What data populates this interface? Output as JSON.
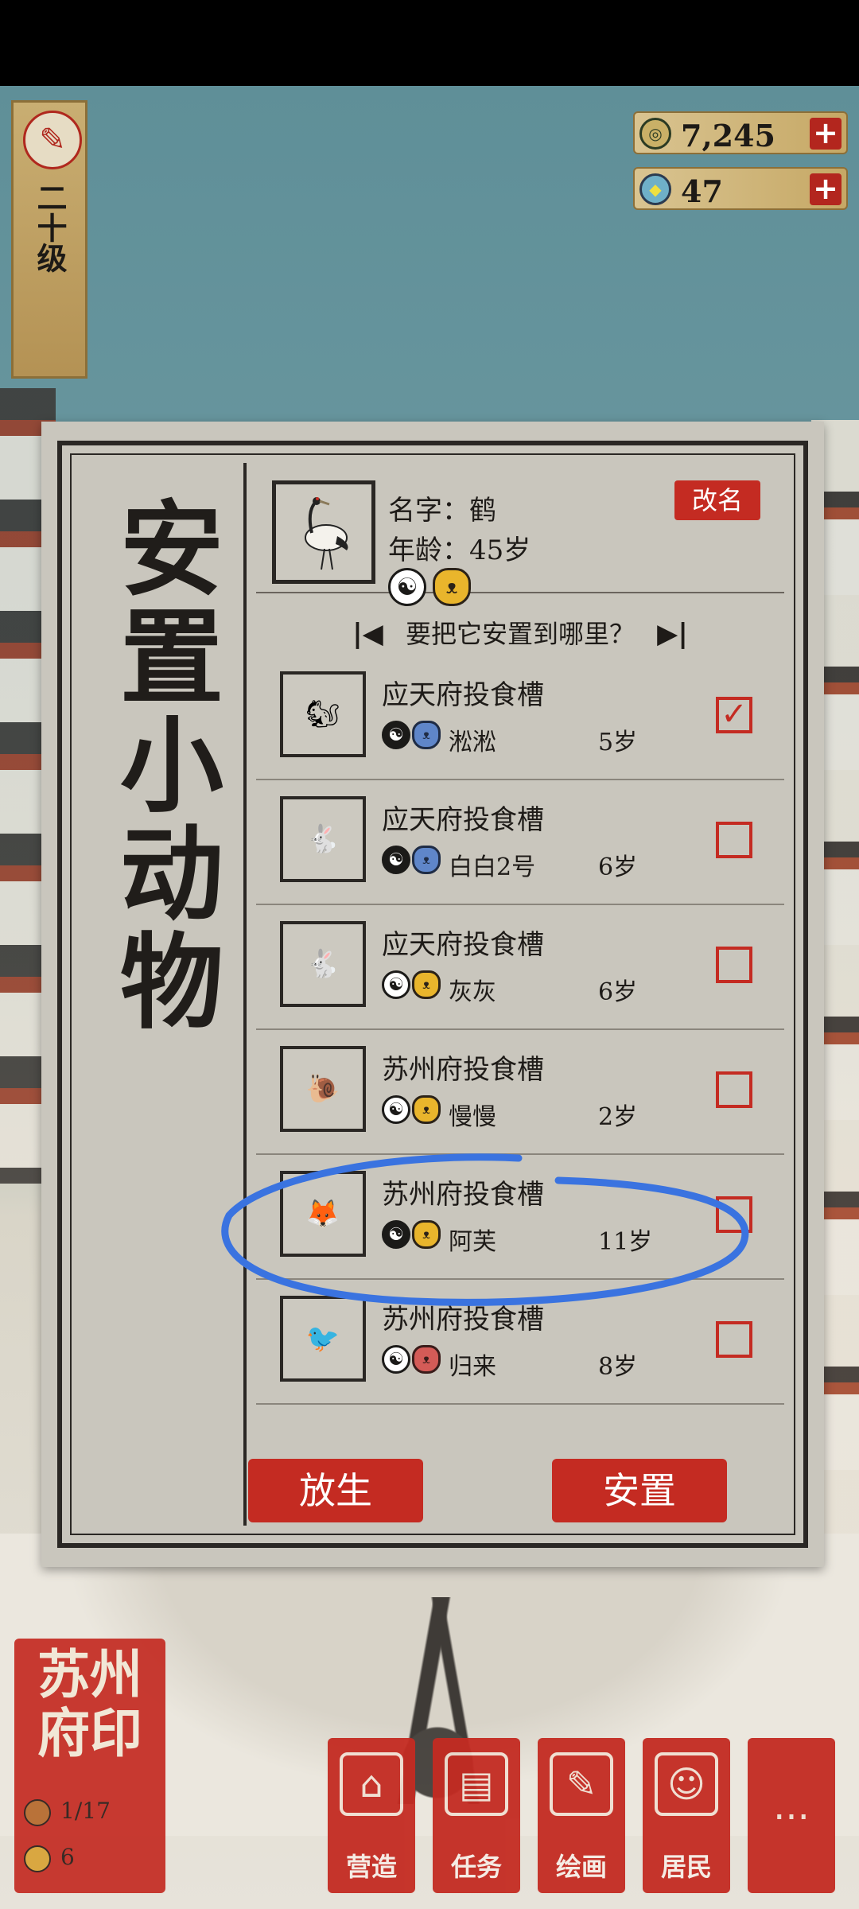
{
  "level": {
    "text": "二十级"
  },
  "currency": [
    {
      "icon": "coin-icon",
      "value": "7,245"
    },
    {
      "icon": "jade-icon",
      "value": "47"
    }
  ],
  "panel": {
    "title": "安置小动物",
    "animal": {
      "name": "名字：鹤",
      "age": "年龄：45岁",
      "traits": [
        "yin-yang-icon",
        "yellow-bear-icon"
      ],
      "rename_label": "改名"
    },
    "prompt": "要把它安置到哪里？",
    "rows": [
      {
        "place": "应天府投食槽",
        "animal_name": "淞淞",
        "age": "5岁",
        "checked": true,
        "portrait": "squirrel"
      },
      {
        "place": "应天府投食槽",
        "animal_name": "白白2号",
        "age": "6岁",
        "checked": false,
        "portrait": "rabbit"
      },
      {
        "place": "应天府投食槽",
        "animal_name": "灰灰",
        "age": "6岁",
        "checked": false,
        "portrait": "rabbit"
      },
      {
        "place": "苏州府投食槽",
        "animal_name": "慢慢",
        "age": "2岁",
        "checked": false,
        "portrait": "snail"
      },
      {
        "place": "苏州府投食槽",
        "animal_name": "阿芙",
        "age": "11岁",
        "checked": false,
        "portrait": "fox"
      },
      {
        "place": "苏州府投食槽",
        "animal_name": "归来",
        "age": "8岁",
        "checked": false,
        "portrait": "swallow"
      }
    ],
    "release_label": "放生",
    "place_label": "安置"
  },
  "seal": {
    "title": "苏州府印",
    "count_1": "1/17",
    "count_2": "6"
  },
  "nav": [
    {
      "label": "营造",
      "icon": "build-icon"
    },
    {
      "label": "任务",
      "icon": "task-icon"
    },
    {
      "label": "绘画",
      "icon": "paint-icon"
    },
    {
      "label": "居民",
      "icon": "resident-icon"
    },
    {
      "label": "",
      "icon": "more-icon"
    }
  ],
  "colors": {
    "accent_red": "#c42b22",
    "annotation_blue": "#3a73e0"
  }
}
